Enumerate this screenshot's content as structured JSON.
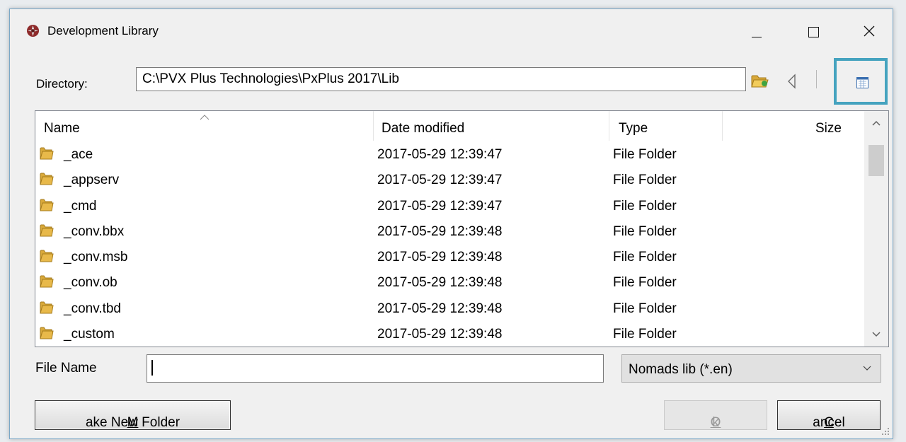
{
  "window": {
    "title": "Development Library",
    "icons": {
      "app": "pvx-app-icon",
      "minimize": "minimize-icon",
      "maximize": "maximize-icon",
      "close": "close-icon"
    }
  },
  "directory": {
    "label": "Directory:",
    "value": "C:\\PVX Plus Technologies\\PxPlus 2017\\Lib",
    "icons": {
      "browse": "folder-open-icon",
      "back": "back-triangle-icon",
      "view": "details-view-icon"
    }
  },
  "list": {
    "columns": {
      "name": "Name",
      "date": "Date modified",
      "type": "Type",
      "size": "Size"
    },
    "rows": [
      {
        "name": "_ace",
        "date": "2017-05-29 12:39:47",
        "type": "File Folder"
      },
      {
        "name": "_appserv",
        "date": "2017-05-29 12:39:47",
        "type": "File Folder"
      },
      {
        "name": "_cmd",
        "date": "2017-05-29 12:39:47",
        "type": "File Folder"
      },
      {
        "name": "_conv.bbx",
        "date": "2017-05-29 12:39:48",
        "type": "File Folder"
      },
      {
        "name": "_conv.msb",
        "date": "2017-05-29 12:39:48",
        "type": "File Folder"
      },
      {
        "name": "_conv.ob",
        "date": "2017-05-29 12:39:48",
        "type": "File Folder"
      },
      {
        "name": "_conv.tbd",
        "date": "2017-05-29 12:39:48",
        "type": "File Folder"
      },
      {
        "name": "_custom",
        "date": "2017-05-29 12:39:48",
        "type": "File Folder"
      }
    ]
  },
  "file_name": {
    "label": "File Name",
    "value": ""
  },
  "filter": {
    "selected": "Nomads lib (*.en)"
  },
  "buttons": {
    "new_folder": {
      "key": "M",
      "rest": "ake New Folder"
    },
    "ok": {
      "key": "O",
      "rest": "k",
      "enabled": false
    },
    "cancel": {
      "key": "C",
      "rest": "ancel"
    }
  },
  "colors": {
    "highlight": "#45a3bf",
    "folder": "#e8b94a"
  }
}
